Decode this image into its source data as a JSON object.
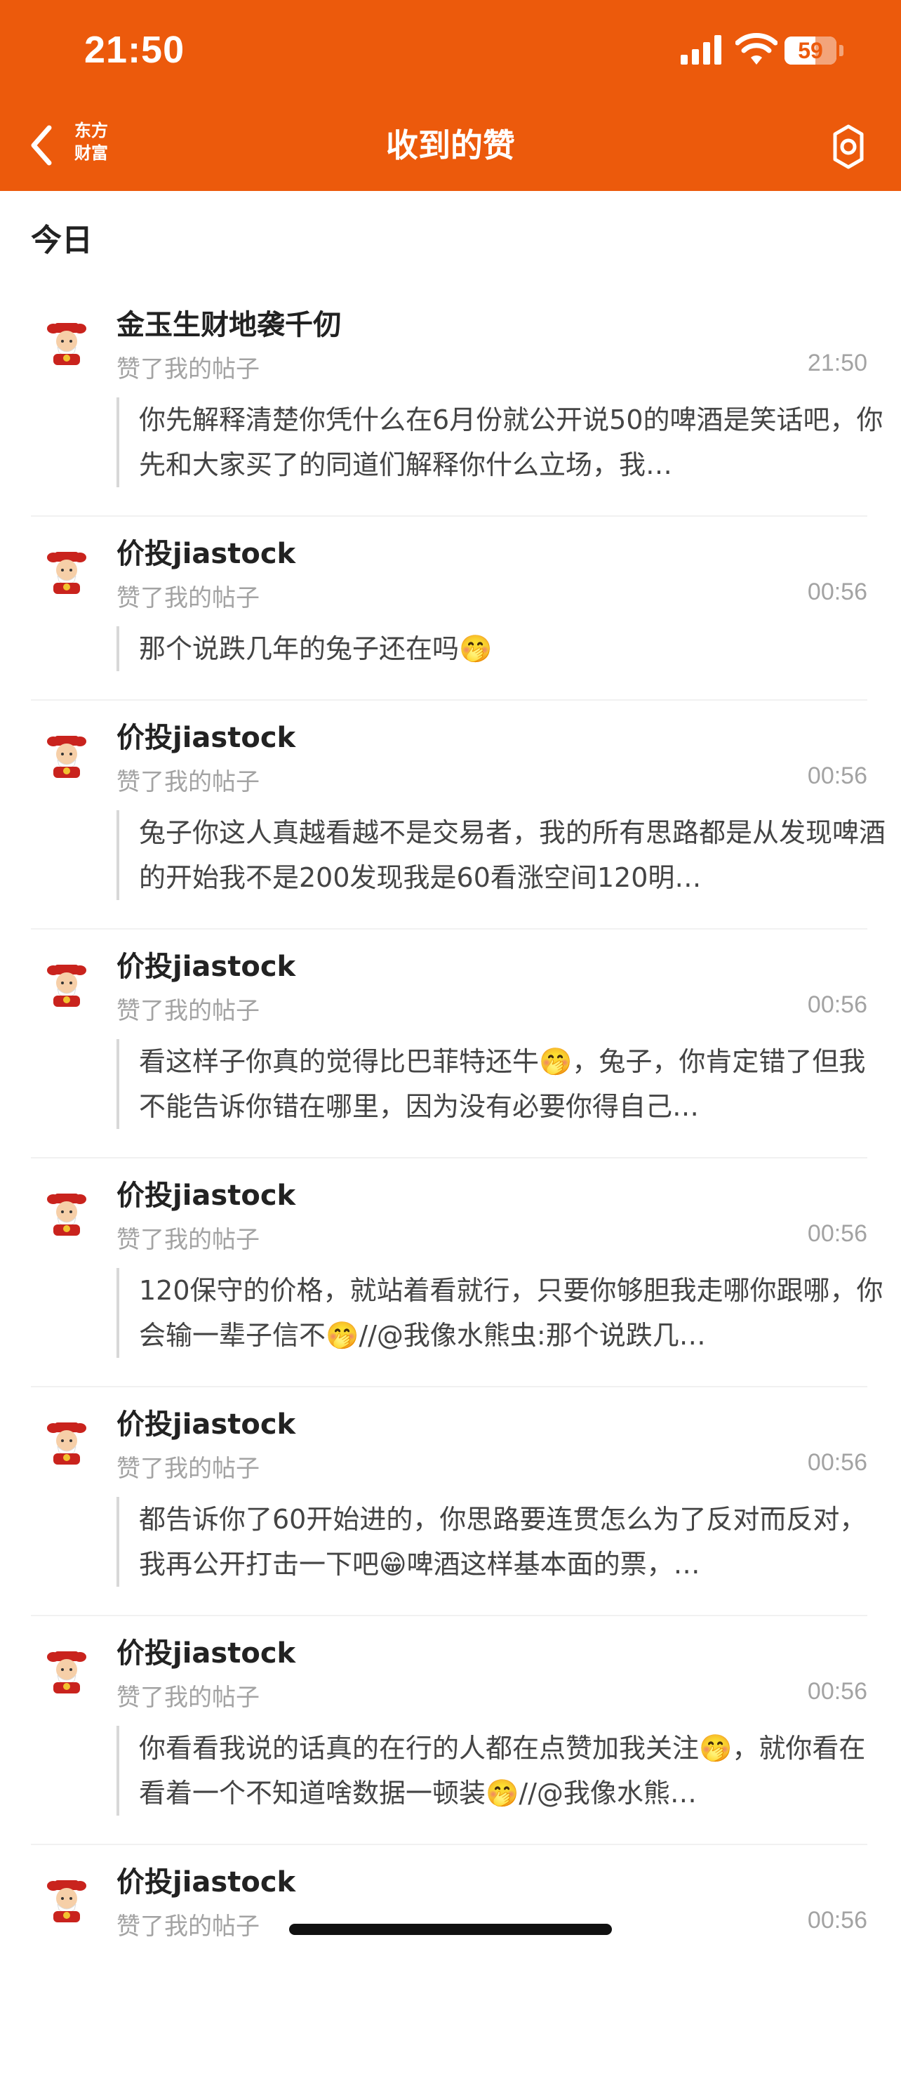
{
  "status_bar": {
    "time": "21:50",
    "battery": "59"
  },
  "nav": {
    "back_icon": "chevron-left-icon",
    "brand_line1": "东方",
    "brand_line2": "财富",
    "title": "收到的赞",
    "settings_icon": "gear-icon"
  },
  "section": {
    "title": "今日"
  },
  "items": [
    {
      "user": "金玉生财地袭千仞",
      "action": "赞了我的帖子",
      "time": "21:50",
      "content": "你先解释清楚你凭什么在6月份就公开说50的啤酒是笑话吧，你先和大家买了的同道们解释你什么立场，我…"
    },
    {
      "user": "价投jiastock",
      "action": "赞了我的帖子",
      "time": "00:56",
      "content": "那个说跌几年的兔子还在吗🤭"
    },
    {
      "user": "价投jiastock",
      "action": "赞了我的帖子",
      "time": "00:56",
      "content": "兔子你这人真越看越不是交易者，我的所有思路都是从发现啤酒的开始我不是200发现我是60看涨空间120明…"
    },
    {
      "user": "价投jiastock",
      "action": "赞了我的帖子",
      "time": "00:56",
      "content": "看这样子你真的觉得比巴菲特还牛🤭，兔子，你肯定错了但我不能告诉你错在哪里，因为没有必要你得自己…"
    },
    {
      "user": "价投jiastock",
      "action": "赞了我的帖子",
      "time": "00:56",
      "content": "120保守的价格，就站着看就行，只要你够胆我走哪你跟哪，你会输一辈子信不🤭//@我像水熊虫:那个说跌几…"
    },
    {
      "user": "价投jiastock",
      "action": "赞了我的帖子",
      "time": "00:56",
      "content": "都告诉你了60开始进的，你思路要连贯怎么为了反对而反对，我再公开打击一下吧😁啤酒这样基本面的票，…"
    },
    {
      "user": "价投jiastock",
      "action": "赞了我的帖子",
      "time": "00:56",
      "content": "你看看我说的话真的在行的人都在点赞加我关注🤭，就你看在看着一个不知道啥数据一顿装🤭//@我像水熊…"
    },
    {
      "user": "价投jiastock",
      "action": "赞了我的帖子",
      "time": "00:56",
      "content": ""
    }
  ]
}
